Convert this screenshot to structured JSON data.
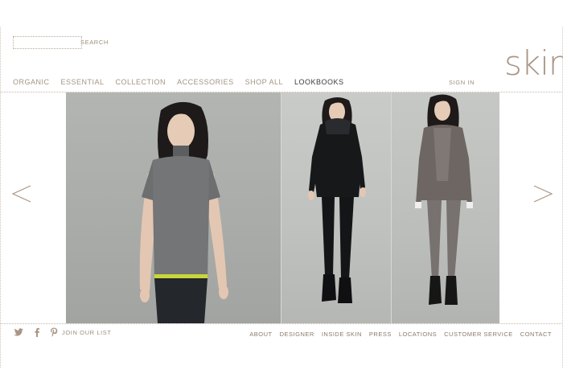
{
  "header": {
    "search_placeholder": "",
    "search_label": "SEARCH",
    "logo_text": "skin",
    "signin_label": "SIGN IN"
  },
  "nav": {
    "items": [
      {
        "label": "ORGANIC"
      },
      {
        "label": "ESSENTIAL"
      },
      {
        "label": "COLLECTION"
      },
      {
        "label": "ACCESSORIES"
      },
      {
        "label": "SHOP ALL"
      },
      {
        "label": "LOOKBOOKS"
      }
    ],
    "active_index": 5
  },
  "gallery": {
    "photos": [
      {
        "name": "model-grey-knit-tee"
      },
      {
        "name": "model-black-hoodie"
      },
      {
        "name": "model-grey-wrap-cardigan"
      }
    ]
  },
  "footer": {
    "social": [
      "twitter-icon",
      "facebook-icon",
      "pinterest-icon"
    ],
    "join_label": "JOIN OUR LIST",
    "links": [
      {
        "label": "ABOUT"
      },
      {
        "label": "DESIGNER"
      },
      {
        "label": "INSIDE SKIN"
      },
      {
        "label": "PRESS"
      },
      {
        "label": "LOCATIONS"
      },
      {
        "label": "CUSTOMER SERVICE"
      },
      {
        "label": "CONTACT"
      }
    ]
  },
  "colors": {
    "accent": "#a99684",
    "nav_text": "#a39482",
    "active_nav": "#3a3a3a",
    "rule": "#c4b7a9",
    "photo_bg": "#b3b5b2"
  }
}
